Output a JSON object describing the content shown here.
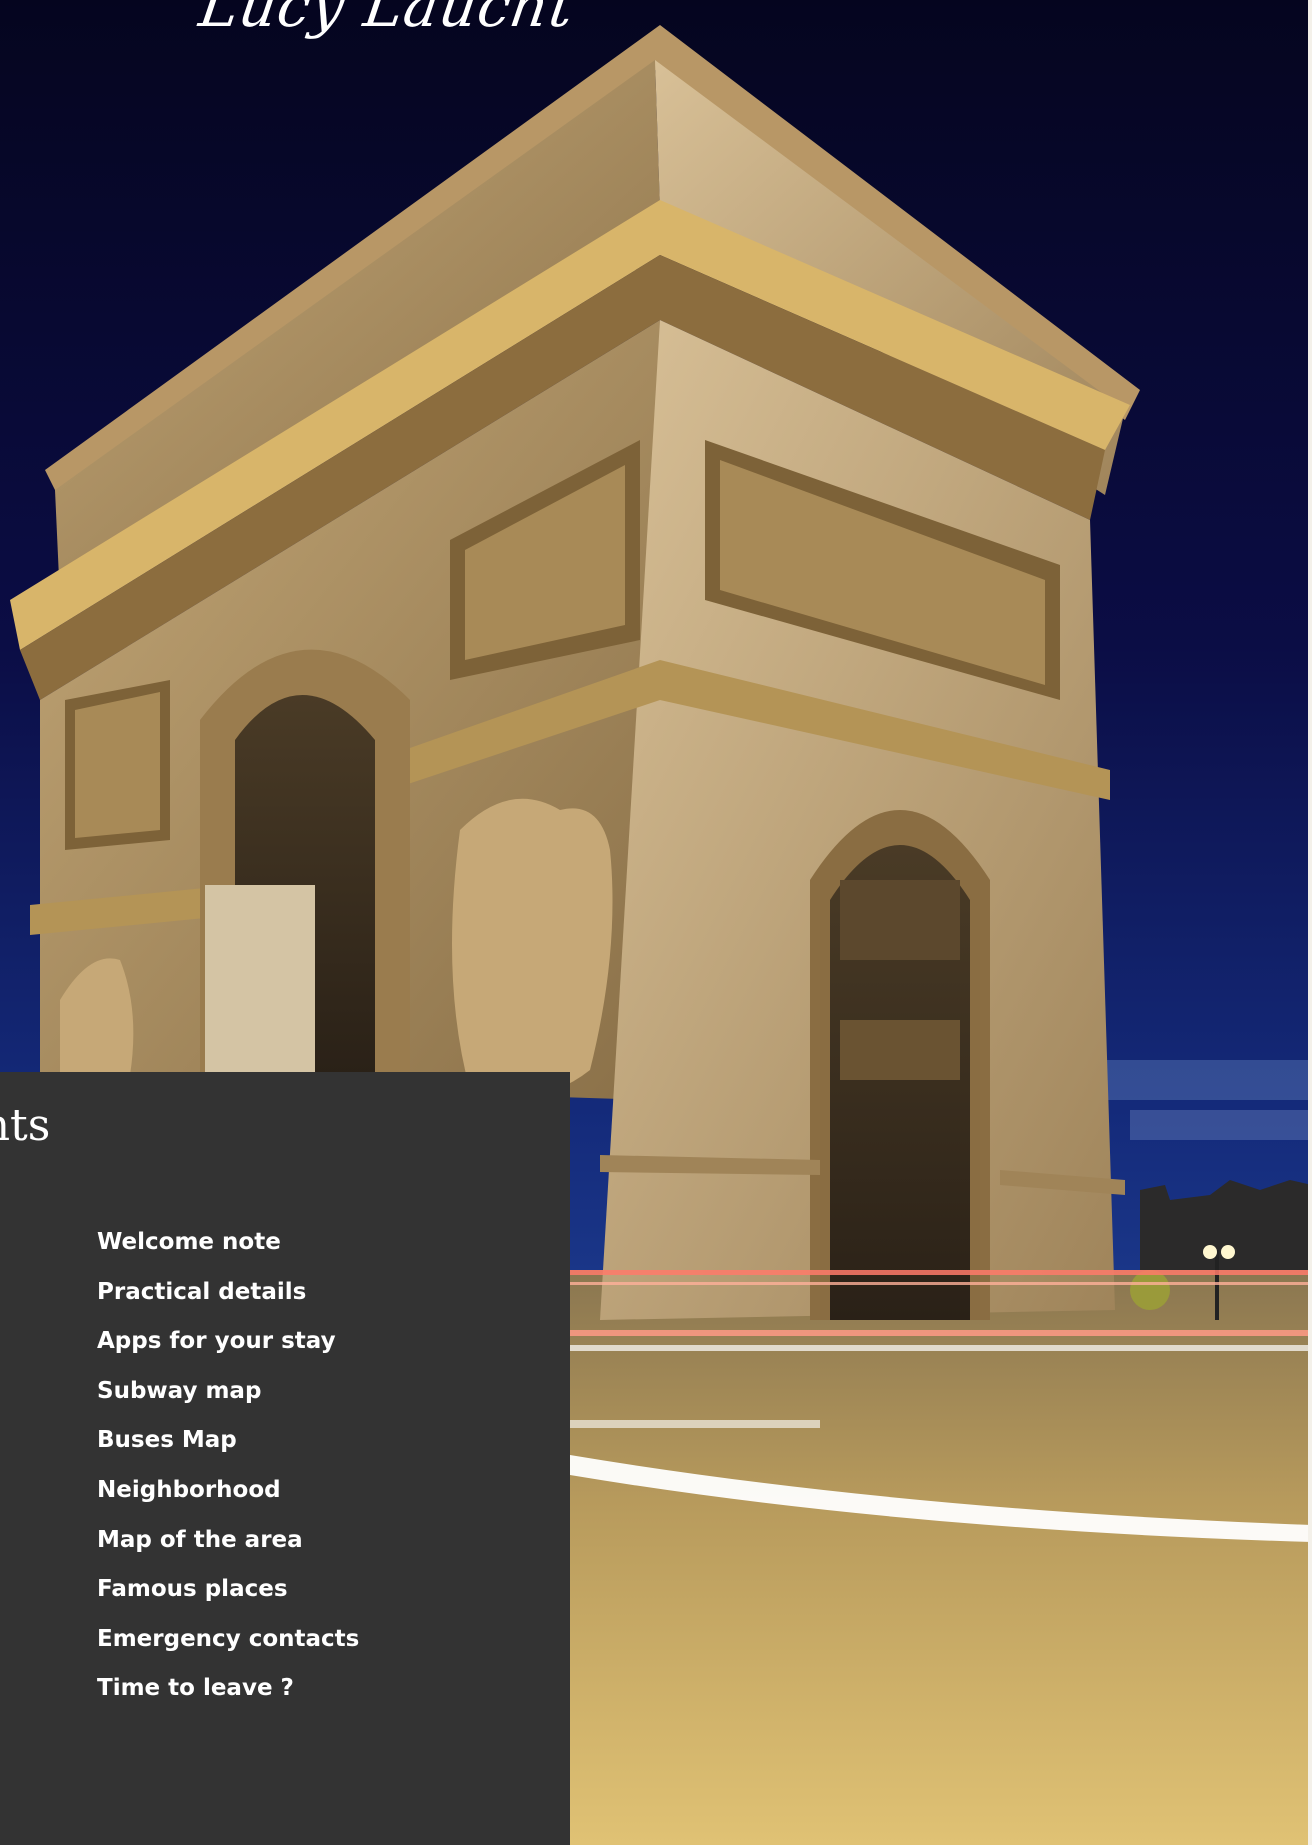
{
  "site": {
    "title": "Lucy Laucht"
  },
  "contents": {
    "heading": "tents",
    "items": [
      {
        "label": "Welcome note"
      },
      {
        "label": "Practical details"
      },
      {
        "label": "Apps for your stay"
      },
      {
        "label": "Subway map"
      },
      {
        "label": "Buses Map"
      },
      {
        "label": "Neighborhood"
      },
      {
        "label": "Map of the area"
      },
      {
        "label": "Famous places"
      },
      {
        "label": "Emergency contacts"
      },
      {
        "label": "Time to leave ?"
      }
    ]
  },
  "colors": {
    "panel_background": "#333333",
    "text": "#ffffff",
    "sky": "#0a0c3a",
    "stone": "#c9ae7e"
  }
}
